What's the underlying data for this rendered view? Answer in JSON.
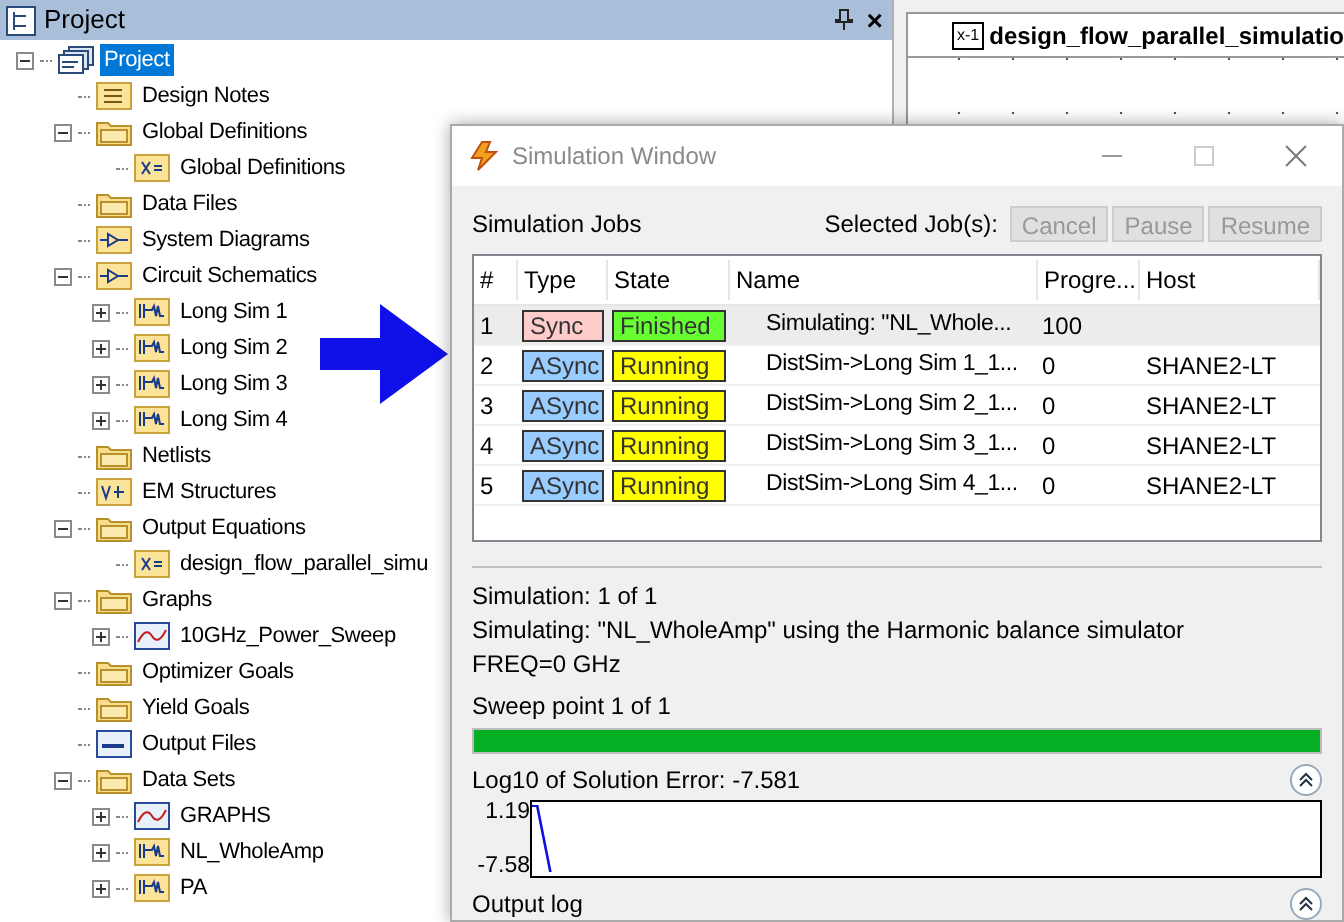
{
  "project_panel": {
    "title": "Project",
    "close": "×"
  },
  "tree": [
    {
      "label": "Project",
      "kind": "project",
      "expanded": true,
      "selected": true,
      "children": [
        {
          "label": "Design Notes",
          "kind": "notes",
          "selected": false
        },
        {
          "label": "Global Definitions",
          "kind": "folder",
          "expanded": true,
          "selected": false,
          "children": [
            {
              "label": "Global Definitions",
              "kind": "equation",
              "selected": false
            }
          ]
        },
        {
          "label": "Data Files",
          "kind": "folder",
          "selected": false
        },
        {
          "label": "System Diagrams",
          "kind": "system",
          "selected": false
        },
        {
          "label": "Circuit Schematics",
          "kind": "system",
          "expanded": true,
          "selected": false,
          "children": [
            {
              "label": "Long Sim 1",
              "kind": "schematic",
              "expanded": false,
              "selected": false
            },
            {
              "label": "Long Sim 2",
              "kind": "schematic",
              "expanded": false,
              "selected": false
            },
            {
              "label": "Long Sim 3",
              "kind": "schematic",
              "expanded": false,
              "selected": false
            },
            {
              "label": "Long Sim 4",
              "kind": "schematic",
              "expanded": false,
              "selected": false
            }
          ]
        },
        {
          "label": "Netlists",
          "kind": "folder",
          "selected": false
        },
        {
          "label": "EM Structures",
          "kind": "em",
          "selected": false
        },
        {
          "label": "Output Equations",
          "kind": "folder",
          "expanded": true,
          "selected": false,
          "children": [
            {
              "label": "design_flow_parallel_simu",
              "kind": "equation",
              "selected": false
            }
          ]
        },
        {
          "label": "Graphs",
          "kind": "folder",
          "expanded": true,
          "selected": false,
          "children": [
            {
              "label": "10GHz_Power_Sweep",
              "kind": "graph",
              "expanded": false,
              "selected": false
            }
          ]
        },
        {
          "label": "Optimizer Goals",
          "kind": "folder",
          "selected": false
        },
        {
          "label": "Yield Goals",
          "kind": "folder",
          "selected": false
        },
        {
          "label": "Output Files",
          "kind": "file",
          "selected": false
        },
        {
          "label": "Data Sets",
          "kind": "folder",
          "expanded": true,
          "selected": false,
          "children": [
            {
              "label": "GRAPHS",
              "kind": "graph",
              "expanded": false,
              "selected": false
            },
            {
              "label": "NL_WholeAmp",
              "kind": "schematic",
              "expanded": false,
              "selected": false
            },
            {
              "label": "PA",
              "kind": "schematic",
              "expanded": false,
              "selected": false
            }
          ]
        }
      ]
    }
  ],
  "document_tab": {
    "icon_text": "x-1",
    "label": "design_flow_parallel_simulatio"
  },
  "simulation_window": {
    "title": "Simulation Window",
    "jobs_label": "Simulation Jobs",
    "selected_jobs_label": "Selected Job(s):",
    "buttons": [
      {
        "label": "Cancel",
        "disabled": true
      },
      {
        "label": "Pause",
        "disabled": true
      },
      {
        "label": "Resume",
        "disabled": true
      }
    ],
    "table": {
      "columns": [
        "#",
        "Type",
        "State",
        "Name",
        "Progre...",
        "Host"
      ],
      "rows": [
        {
          "num": "1",
          "type": {
            "label": "Sync",
            "color": "#ffcccc"
          },
          "state": {
            "label": "Finished",
            "color": "#66ff33"
          },
          "name": "Simulating: \"NL_Whole...",
          "progress": "100",
          "host": "",
          "selected": true
        },
        {
          "num": "2",
          "type": {
            "label": "ASync",
            "color": "#99ccff"
          },
          "state": {
            "label": "Running",
            "color": "#ffff00"
          },
          "name": "DistSim->Long Sim 1_1...",
          "progress": "0",
          "host": "SHANE2-LT",
          "selected": false
        },
        {
          "num": "3",
          "type": {
            "label": "ASync",
            "color": "#99ccff"
          },
          "state": {
            "label": "Running",
            "color": "#ffff00"
          },
          "name": "DistSim->Long Sim 2_1...",
          "progress": "0",
          "host": "SHANE2-LT",
          "selected": false
        },
        {
          "num": "4",
          "type": {
            "label": "ASync",
            "color": "#99ccff"
          },
          "state": {
            "label": "Running",
            "color": "#ffff00"
          },
          "name": "DistSim->Long Sim 3_1...",
          "progress": "0",
          "host": "SHANE2-LT",
          "selected": false
        },
        {
          "num": "5",
          "type": {
            "label": "ASync",
            "color": "#99ccff"
          },
          "state": {
            "label": "Running",
            "color": "#ffff00"
          },
          "name": "DistSim->Long Sim 4_1...",
          "progress": "0",
          "host": "SHANE2-LT",
          "selected": false
        }
      ]
    },
    "status_lines": [
      "Simulation: 1 of 1",
      "Simulating: \"NL_WholeAmp\" using the Harmonic balance simulator",
      "FREQ=0 GHz"
    ],
    "sweep": {
      "label": "Sweep point 1 of 1",
      "level": 1
    },
    "error_plot": {
      "label": "Log10 of Solution Error: -7.581",
      "y_max_label": "1.19",
      "y_min_label": "-7.58"
    },
    "output_log": {
      "label": "Output log"
    }
  }
}
